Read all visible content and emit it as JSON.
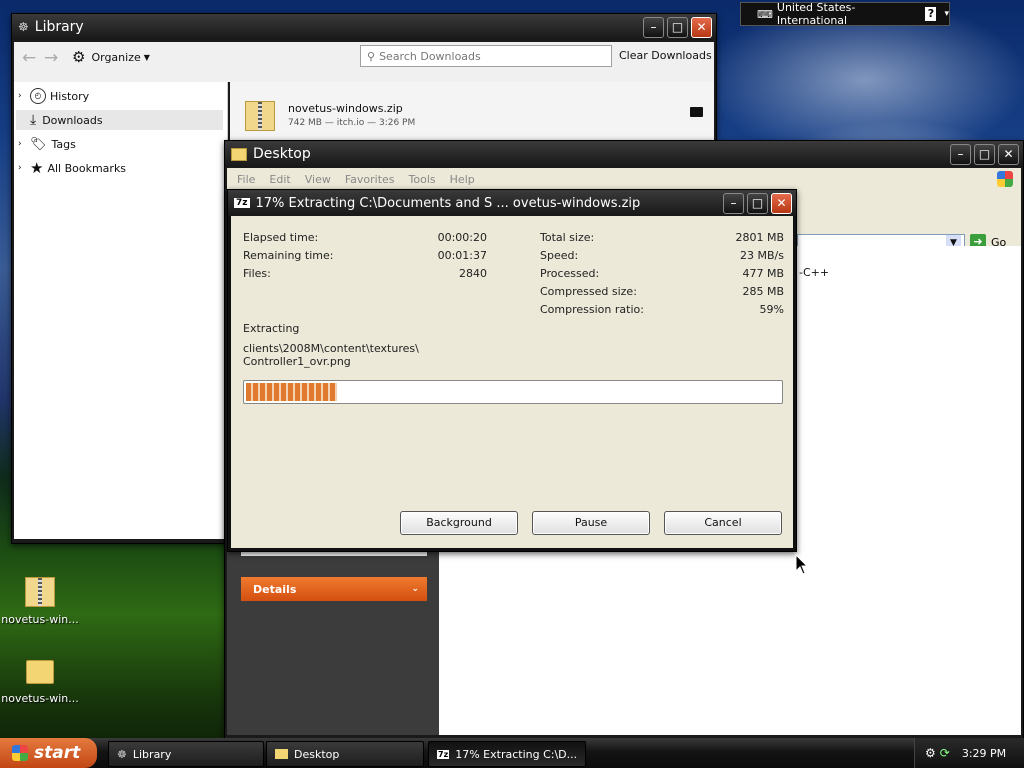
{
  "library": {
    "title": "Library",
    "organize_label": "Organize",
    "search_placeholder": "Search Downloads",
    "clear_label": "Clear Downloads",
    "sidebar": [
      {
        "label": "History",
        "icon": "clock-icon"
      },
      {
        "label": "Downloads",
        "icon": "download-icon"
      },
      {
        "label": "Tags",
        "icon": "tag-icon"
      },
      {
        "label": "All Bookmarks",
        "icon": "star-icon"
      }
    ],
    "download": {
      "name": "novetus-windows.zip",
      "meta": "742 MB — itch.io — 3:26 PM"
    }
  },
  "explorer": {
    "title": "Desktop",
    "menu": [
      "File",
      "Edit",
      "View",
      "Favorites",
      "Tools",
      "Help"
    ],
    "go_label": "Go",
    "details_label": "Details",
    "partial_text": "-C++"
  },
  "zip": {
    "title": "17% Extracting C:\\Documents and S ... ovetus-windows.zip",
    "left_stats": [
      {
        "label": "Elapsed time:",
        "value": "00:00:20"
      },
      {
        "label": "Remaining time:",
        "value": "00:01:37"
      },
      {
        "label": "Files:",
        "value": "2840"
      }
    ],
    "right_stats": [
      {
        "label": "Total size:",
        "value": "2801 MB"
      },
      {
        "label": "Speed:",
        "value": "23 MB/s"
      },
      {
        "label": "Processed:",
        "value": "477 MB"
      },
      {
        "label": "Compressed size:",
        "value": "285 MB"
      },
      {
        "label": "Compression ratio:",
        "value": "59%"
      }
    ],
    "extracting_label": "Extracting",
    "current_path": "clients\\2008M\\content\\textures\\",
    "current_file": "Controller1_ovr.png",
    "progress": 0.17,
    "buttons": {
      "background": "Background",
      "pause": "Pause",
      "cancel": "Cancel"
    }
  },
  "language_bar": {
    "label": "United States-International"
  },
  "desktop_icons": [
    {
      "label": "novetus-win..."
    },
    {
      "label": "novetus-win..."
    }
  ],
  "taskbar": {
    "start_label": "start",
    "tasks": [
      "Library",
      "Desktop",
      "17% Extracting C:\\D..."
    ],
    "clock": "3:29 PM"
  },
  "colors": {
    "accent_orange": "#e8631c",
    "progress_fill": "#e07a2e"
  }
}
